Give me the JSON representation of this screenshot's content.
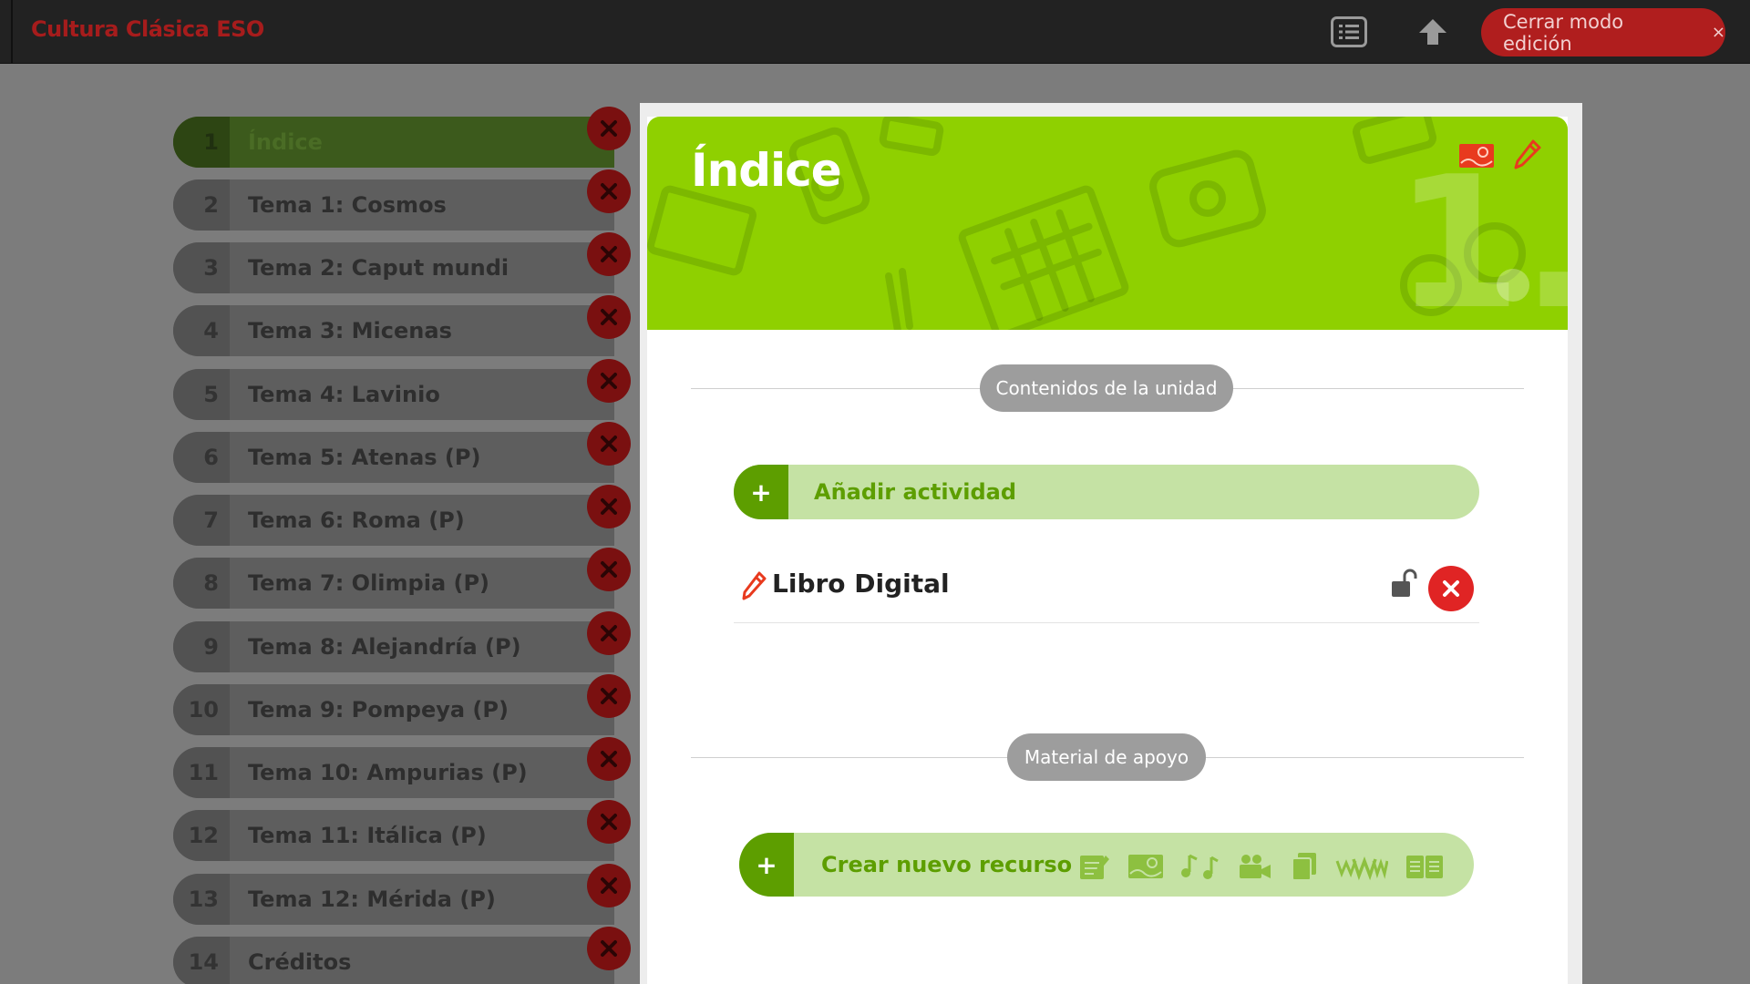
{
  "app": {
    "title": "Cultura Clásica ESO"
  },
  "toolbar": {
    "close_edit_label": "Cerrar modo edición",
    "close_edit_x": "×"
  },
  "sidebar": {
    "items": [
      {
        "num": "1",
        "label": "Índice",
        "active": true
      },
      {
        "num": "2",
        "label": "Tema 1: Cosmos"
      },
      {
        "num": "3",
        "label": "Tema 2: Caput mundi"
      },
      {
        "num": "4",
        "label": "Tema 3: Micenas"
      },
      {
        "num": "5",
        "label": "Tema 4: Lavinio"
      },
      {
        "num": "6",
        "label": "Tema 5: Atenas (P)"
      },
      {
        "num": "7",
        "label": "Tema 6: Roma (P)"
      },
      {
        "num": "8",
        "label": "Tema 7: Olimpia (P)"
      },
      {
        "num": "9",
        "label": "Tema 8: Alejandría (P)"
      },
      {
        "num": "10",
        "label": "Tema 9: Pompeya (P)"
      },
      {
        "num": "11",
        "label": "Tema 10: Ampurias (P)"
      },
      {
        "num": "12",
        "label": "Tema 11: Itálica (P)"
      },
      {
        "num": "13",
        "label": "Tema 12: Mérida (P)"
      },
      {
        "num": "14",
        "label": "Créditos"
      }
    ]
  },
  "banner": {
    "title": "Índice",
    "big_number": "1."
  },
  "contents": {
    "section_label": "Contenidos de la unidad",
    "add_activity_plus": "+",
    "add_activity_label": "Añadir actividad",
    "resource_title": "Libro Digital"
  },
  "support": {
    "section_label": "Material de apoyo",
    "create_plus": "+",
    "create_label": "Crear nuevo recurso",
    "resource_type_icons": [
      "document-icon",
      "image-icon",
      "music-icon",
      "video-icon",
      "files-icon",
      "web-icon",
      "book-icon"
    ]
  },
  "colors": {
    "accent_green": "#8fd000",
    "dark_green": "#5d9e00",
    "light_green": "#c5e2a4",
    "danger_red": "#e02424",
    "topbar": "#222222"
  }
}
